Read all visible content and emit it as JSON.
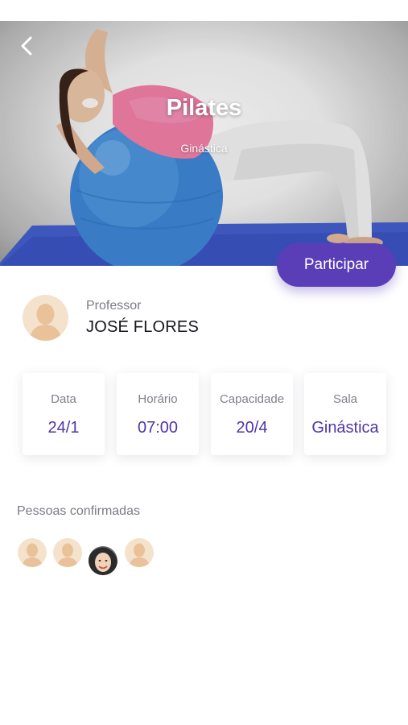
{
  "class": {
    "title": "Pilates",
    "category": "Ginástica",
    "join_label": "Participar"
  },
  "professor": {
    "label": "Professor",
    "name": "JOSÉ FLORES"
  },
  "info_cards": [
    {
      "label": "Data",
      "value": "24/1"
    },
    {
      "label": "Horário",
      "value": "07:00"
    },
    {
      "label": "Capacidade",
      "value": "20/4"
    },
    {
      "label": "Sala",
      "value": "Ginástica"
    }
  ],
  "confirmed": {
    "title": "Pessoas confirmadas",
    "avatars": [
      "default-avatar-icon",
      "default-avatar-icon",
      "photo-avatar",
      "default-avatar-icon"
    ]
  },
  "colors": {
    "accent": "#5a3eb8",
    "value_text": "#4d36a8",
    "avatar_bg": "#f5e2cc",
    "avatar_figure": "#e9c29a"
  },
  "icons": {
    "back": "chevron-left-icon"
  }
}
